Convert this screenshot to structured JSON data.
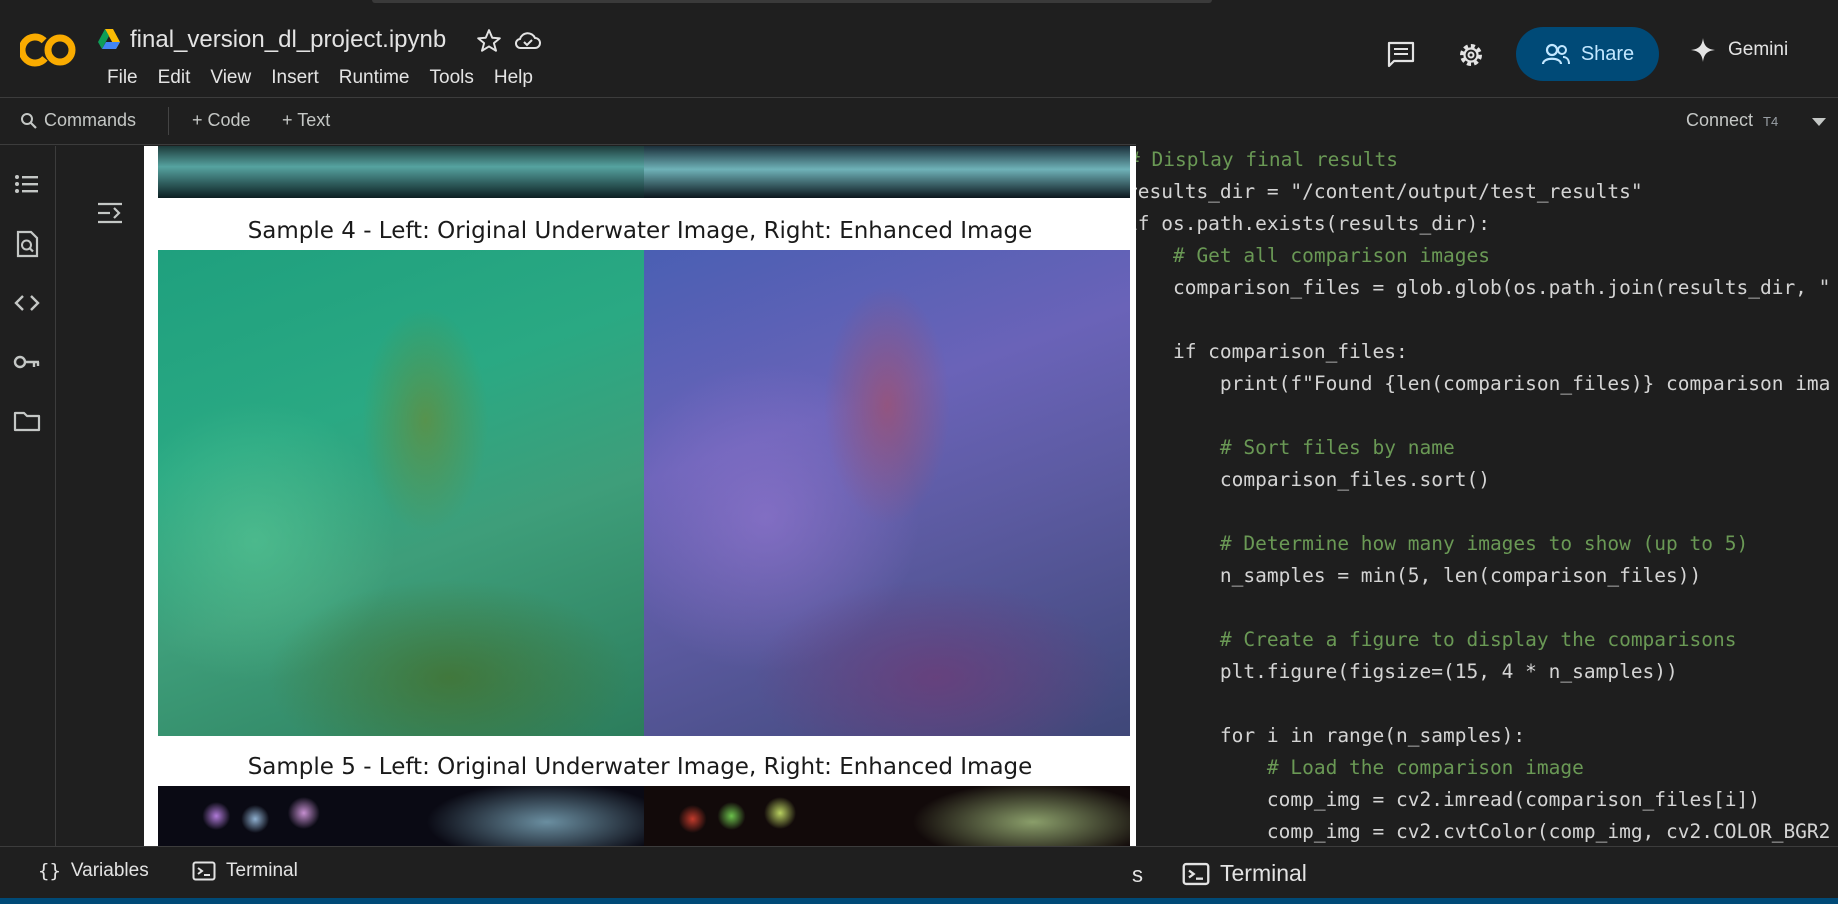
{
  "header": {
    "logo_text": "CO",
    "notebook_title": "final_version_dl_project.ipynb",
    "menu": [
      "File",
      "Edit",
      "View",
      "Insert",
      "Runtime",
      "Tools",
      "Help"
    ],
    "share_label": "Share",
    "gemini_label": "Gemini"
  },
  "toolbar": {
    "commands_label": "Commands",
    "add_code_label": "+ Code",
    "add_text_label": "+ Text",
    "connect_label": "Connect",
    "connect_sub": "T4"
  },
  "output": {
    "caption_4": "Sample 4 - Left: Original Underwater Image, Right: Enhanced Image",
    "caption_5": "Sample 5 - Left: Original Underwater Image, Right: Enhanced Image"
  },
  "code": {
    "lines": [
      "# Display final results",
      "results_dir = \"/content/output/test_results\"",
      "if os.path.exists(results_dir):",
      "    # Get all comparison images",
      "    comparison_files = glob.glob(os.path.join(results_dir, \"",
      "",
      "    if comparison_files:",
      "        print(f\"Found {len(comparison_files)} comparison ima",
      "",
      "        # Sort files by name",
      "        comparison_files.sort()",
      "",
      "        # Determine how many images to show (up to 5)",
      "        n_samples = min(5, len(comparison_files))",
      "",
      "        # Create a figure to display the comparisons",
      "        plt.figure(figsize=(15, 4 * n_samples))",
      "",
      "        for i in range(n_samples):",
      "            # Load the comparison image",
      "            comp_img = cv2.imread(comparison_files[i])",
      "            comp_img = cv2.cvtColor(comp_img, cv2.COLOR_BGR2"
    ]
  },
  "bottom": {
    "variables_label": "Variables",
    "terminal_label": "Terminal",
    "partial_label": "s",
    "terminal_label_2": "Terminal"
  },
  "colors": {
    "accent": "#004a77",
    "logo_orange": "#f9ab00",
    "background": "#1f1f1f"
  }
}
